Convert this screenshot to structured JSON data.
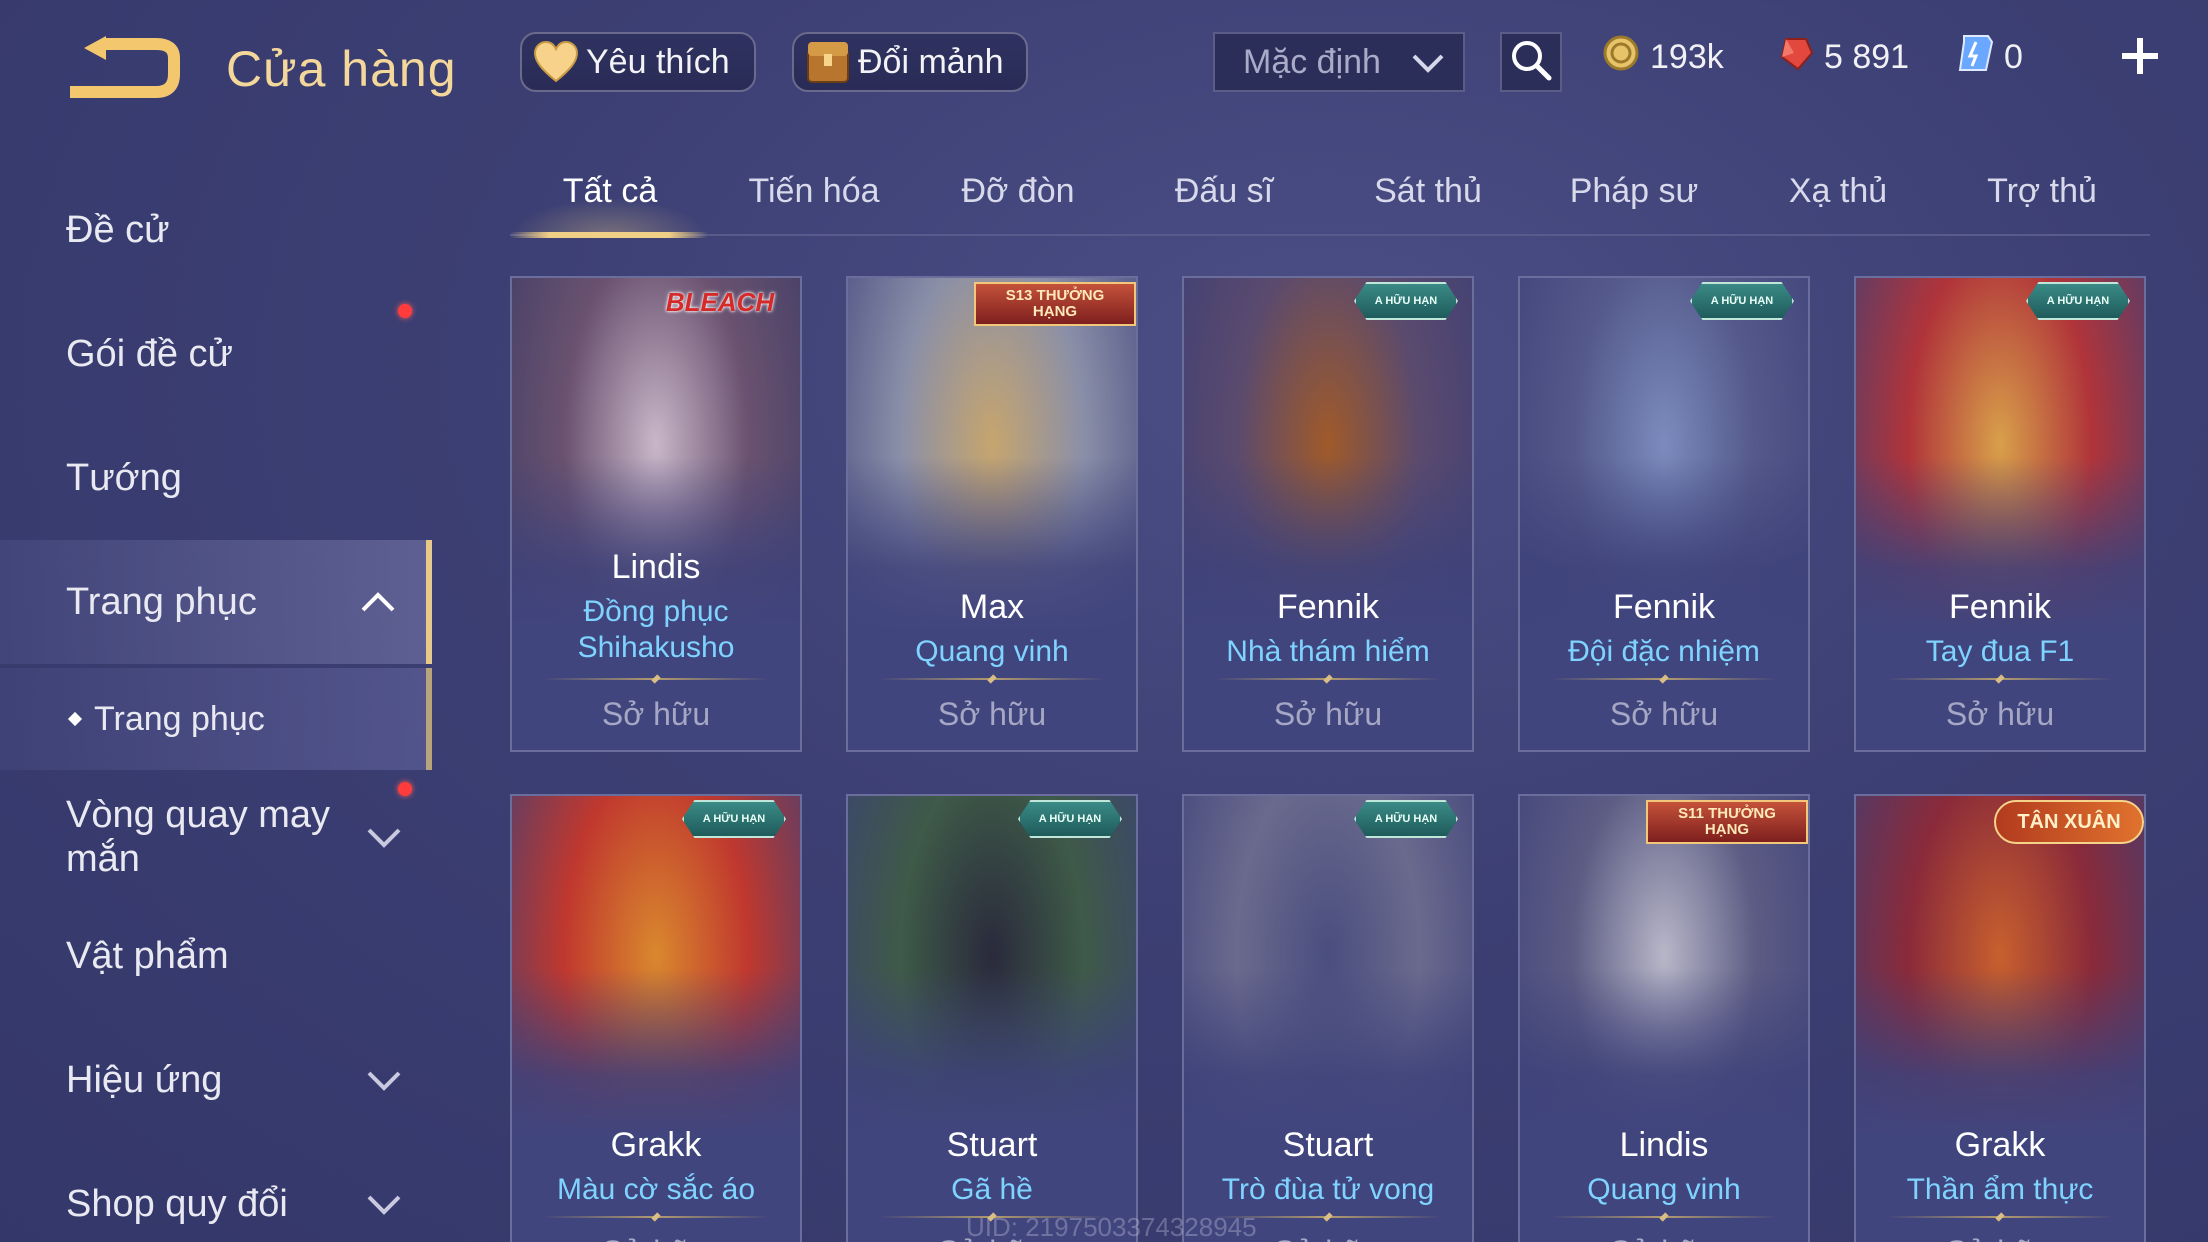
{
  "header": {
    "title": "Cửa hàng",
    "favorite_label": "Yêu thích",
    "shard_label": "Đổi mảnh",
    "sort_value": "Mặc định",
    "currencies": {
      "gold": "193k",
      "ruby": "5 891",
      "gem": "0"
    }
  },
  "sidebar": {
    "items": [
      {
        "label": "Đề cử"
      },
      {
        "label": "Gói đề cử"
      },
      {
        "label": "Tướng"
      },
      {
        "label": "Trang phục"
      },
      {
        "label": "Trang phục"
      },
      {
        "label": "Vòng quay may mắn"
      },
      {
        "label": "Vật phẩm"
      },
      {
        "label": "Hiệu ứng"
      },
      {
        "label": "Shop quy đổi"
      }
    ]
  },
  "tabs": [
    "Tất cả",
    "Tiến hóa",
    "Đỡ đòn",
    "Đấu sĩ",
    "Sát thủ",
    "Pháp sư",
    "Xạ thủ",
    "Trợ thủ"
  ],
  "cards": [
    {
      "hero": "Lindis",
      "skin": "Đồng phục Shihakusho",
      "status": "Sở hữu",
      "badge": "BLEACH",
      "colors": [
        "#c9b7c9",
        "#6a5270",
        "#3b3a64"
      ]
    },
    {
      "hero": "Max",
      "skin": "Quang vinh",
      "status": "Sở hữu",
      "badge": "S13 THƯỞNG HẠNG",
      "colors": [
        "#c6a56e",
        "#8a8fa8",
        "#40447c"
      ]
    },
    {
      "hero": "Fennik",
      "skin": "Nhà thám hiểm",
      "status": "Sở hữu",
      "badge": "A HỮU HẠN",
      "colors": [
        "#a05a2a",
        "#5a4a6e",
        "#3a3e76"
      ]
    },
    {
      "hero": "Fennik",
      "skin": "Đội đặc nhiệm",
      "status": "Sở hữu",
      "badge": "A HỮU HẠN",
      "colors": [
        "#7b8bbd",
        "#54588a",
        "#3c4078"
      ]
    },
    {
      "hero": "Fennik",
      "skin": "Tay đua F1",
      "status": "Sở hữu",
      "badge": "A HỮU HẠN",
      "colors": [
        "#d8a04a",
        "#b0343a",
        "#3c4078"
      ]
    },
    {
      "hero": "Grakk",
      "skin": "Màu cờ sắc áo",
      "status": "Sở hữu",
      "badge": "A HỮU HẠN",
      "colors": [
        "#d9882e",
        "#c0382e",
        "#3c4078"
      ]
    },
    {
      "hero": "Stuart",
      "skin": "Gã hề",
      "status": "Sở hữu",
      "badge": "A HỮU HẠN",
      "colors": [
        "#2a2a3c",
        "#3e5a48",
        "#3c4078"
      ]
    },
    {
      "hero": "Stuart",
      "skin": "Trò đùa tử vong",
      "status": "Sở hữu",
      "badge": "A HỮU HẠN",
      "colors": [
        "#4a4e7e",
        "#6a6a8e",
        "#3c4078"
      ]
    },
    {
      "hero": "Lindis",
      "skin": "Quang vinh",
      "status": "Sở hữu",
      "badge": "S11 THƯỞNG HẠNG",
      "colors": [
        "#b8b6c8",
        "#5c5c84",
        "#3c4078"
      ]
    },
    {
      "hero": "Grakk",
      "skin": "Thần ẩm thực",
      "status": "Sở hữu",
      "badge": "TÂN XUÂN",
      "colors": [
        "#c8602e",
        "#8a2a3a",
        "#3c4078"
      ]
    }
  ],
  "footer": {
    "uid": "UID: 2197503374328945"
  },
  "colors": {
    "accent": "#f4d79a",
    "skin_name": "#7fd3ff",
    "background": "#3c3f73"
  }
}
